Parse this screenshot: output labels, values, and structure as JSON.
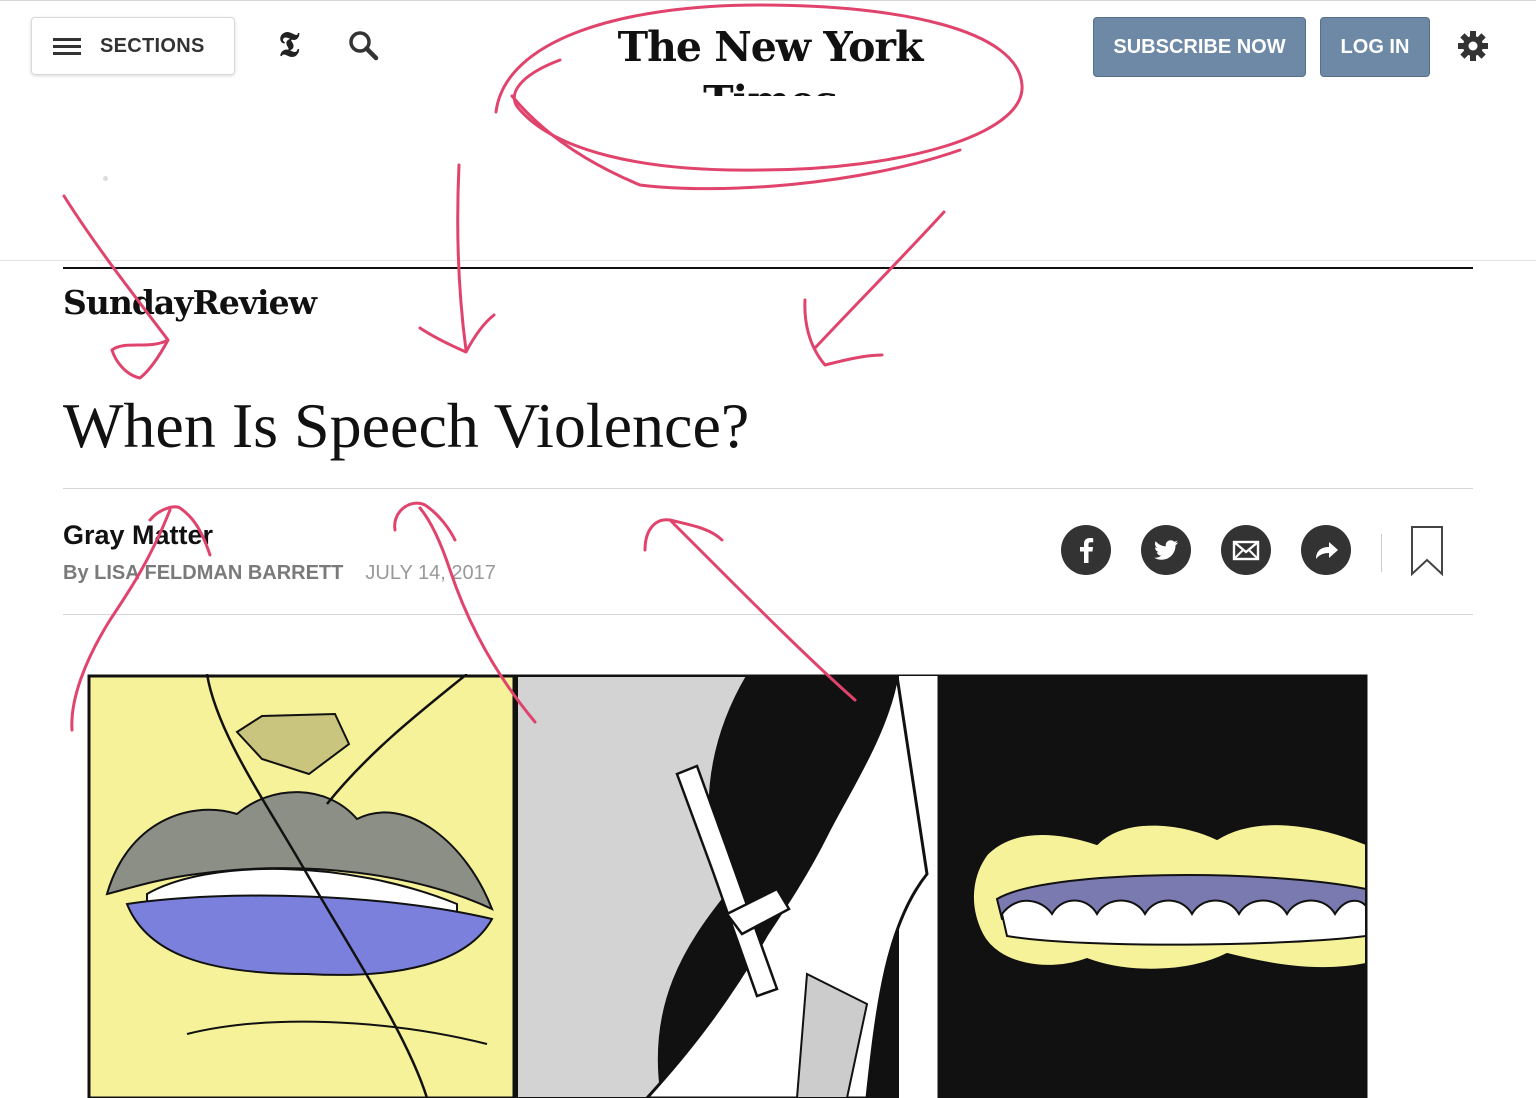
{
  "header": {
    "sections_label": "SECTIONS",
    "masthead": "The New York Times",
    "subscribe_label": "SUBSCRIBE NOW",
    "login_label": "LOG IN",
    "t_logo": "𝕿"
  },
  "article": {
    "section": "SundayReview",
    "headline": "When Is Speech Violence?",
    "column": "Gray Matter",
    "byline_prefix": "By ",
    "author": "LISA FELDMAN BARRETT",
    "date": "JULY 14, 2017"
  },
  "icons": {
    "menu": "hamburger-icon",
    "search": "search-icon",
    "settings": "gear-icon",
    "share": [
      "facebook-icon",
      "twitter-icon",
      "email-icon",
      "share-arrow-icon"
    ],
    "save": "bookmark-icon"
  },
  "colors": {
    "button_bg": "#6e89a6",
    "annotation": "#e0446d",
    "illustration_yellow": "#f6f29a",
    "illustration_lip_blue": "#7b80dd",
    "illustration_lip_gray": "#8c8f86"
  }
}
